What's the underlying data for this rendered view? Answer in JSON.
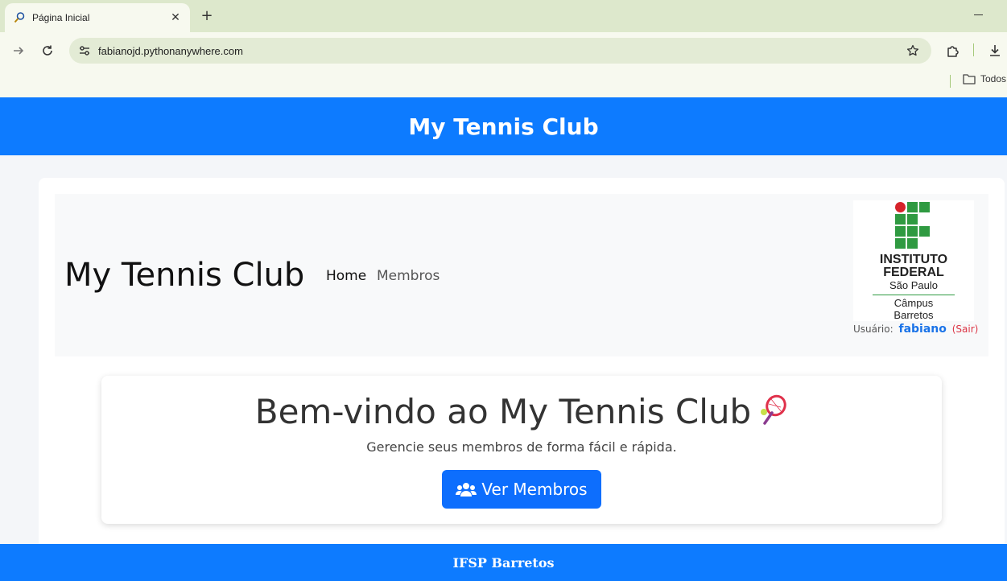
{
  "browser": {
    "tab_title": "Página Inicial",
    "url": "fabianojd.pythonanywhere.com",
    "bookmark_folder": "Todos"
  },
  "header": {
    "title": "My Tennis Club"
  },
  "navbar": {
    "brand": "My Tennis Club",
    "links": [
      "Home",
      "Membros"
    ]
  },
  "logo": {
    "line1": "INSTITUTO",
    "line2": "FEDERAL",
    "line3": "São Paulo",
    "line4": "Câmpus",
    "line5": "Barretos"
  },
  "user": {
    "label": "Usuário:",
    "name": "fabiano",
    "logout": "(Sair)"
  },
  "hero": {
    "title": "Bem-vindo ao My Tennis Club",
    "subtitle": "Gerencie seus membros de forma fácil e rápida.",
    "button": "Ver Membros"
  },
  "footer": {
    "text": "IFSP Barretos"
  },
  "colors": {
    "primary": "#0d7bff",
    "button": "#0d6efd",
    "logo_green": "#2f9a41",
    "logo_red": "#d6232a",
    "logout": "#dc3545"
  }
}
